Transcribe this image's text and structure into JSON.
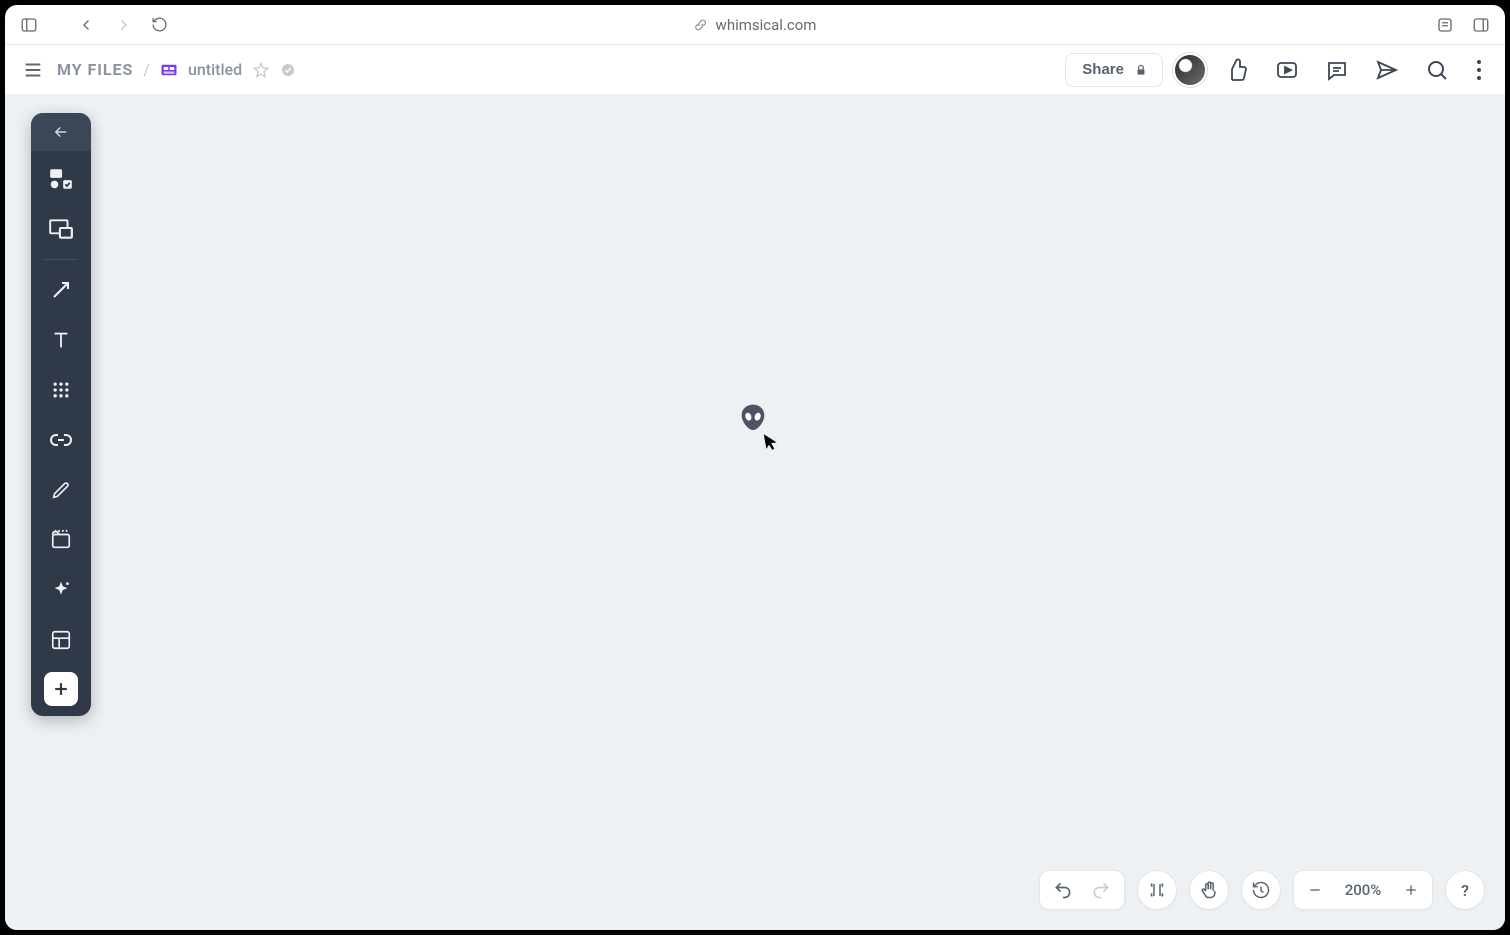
{
  "browser": {
    "domain": "whimsical.com"
  },
  "header": {
    "breadcrumb_root": "MY FILES",
    "breadcrumb_sep": "/",
    "file_title": "untitled",
    "share_label": "Share"
  },
  "zoom": {
    "value": "200%"
  },
  "help": {
    "label": "?"
  }
}
